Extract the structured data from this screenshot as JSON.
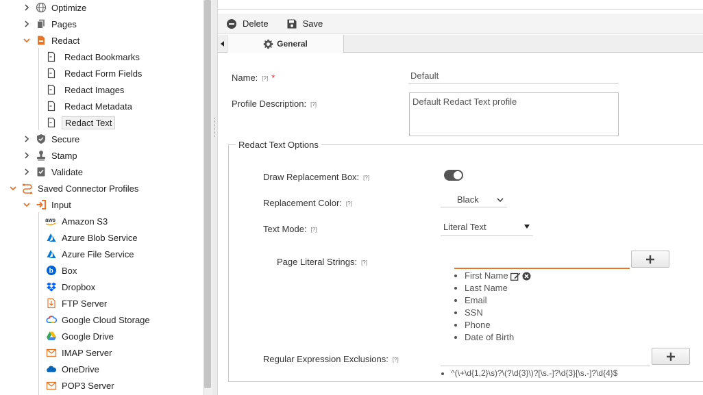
{
  "sidebar": {
    "optimize": "Optimize",
    "pages": "Pages",
    "redact": "Redact",
    "redact_items": [
      "Redact Bookmarks",
      "Redact Form Fields",
      "Redact Images",
      "Redact Metadata",
      "Redact Text"
    ],
    "secure": "Secure",
    "stamp": "Stamp",
    "validate": "Validate",
    "saved_connector_profiles": "Saved Connector Profiles",
    "input": "Input",
    "connectors": [
      "Amazon S3",
      "Azure Blob Service",
      "Azure File Service",
      "Box",
      "Dropbox",
      "FTP Server",
      "Google Cloud Storage",
      "Google Drive",
      "IMAP Server",
      "OneDrive",
      "POP3 Server"
    ]
  },
  "toolbar": {
    "delete_label": "Delete",
    "save_label": "Save"
  },
  "tabs": {
    "general": "General"
  },
  "form": {
    "help": "[?]",
    "required": "*",
    "name_label": "Name:",
    "name_value": "Default",
    "description_label": "Profile Description:",
    "description_value": "Default Redact Text profile",
    "section_title": "Redact Text Options",
    "draw_box_label": "Draw Replacement Box:",
    "draw_box_on": true,
    "color_label": "Replacement Color:",
    "color_value": "Black",
    "text_mode_label": "Text Mode:",
    "text_mode_value": "Literal Text",
    "page_literal_label": "Page Literal Strings:",
    "literal_strings": [
      "First Name",
      "Last Name",
      "Email",
      "SSN",
      "Phone",
      "Date of Birth"
    ],
    "regex_label": "Regular Expression Exclusions:",
    "regex_values": [
      "^(\\+\\d{1,2}\\s)?\\(?\\d{3}\\)?[\\s.-]?\\d{3}[\\s.-]?\\d{4}$"
    ]
  },
  "colors": {
    "accent": "#e8742a",
    "azure": "#0078d4",
    "dropbox": "#0061fe"
  }
}
